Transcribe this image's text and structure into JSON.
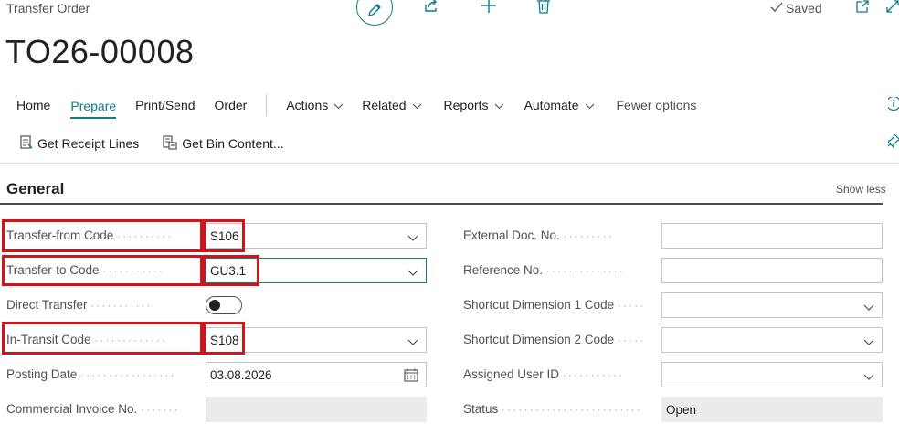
{
  "header": {
    "page_caption": "Transfer Order",
    "document_no": "TO26-00008",
    "saved_status": "Saved"
  },
  "menu": {
    "items": [
      {
        "label": "Home"
      },
      {
        "label": "Prepare",
        "active": true
      },
      {
        "label": "Print/Send"
      },
      {
        "label": "Order"
      },
      {
        "label": "Actions",
        "dropdown": true
      },
      {
        "label": "Related",
        "dropdown": true
      },
      {
        "label": "Reports",
        "dropdown": true
      },
      {
        "label": "Automate",
        "dropdown": true
      },
      {
        "label": "Fewer options"
      }
    ]
  },
  "subbar": {
    "get_receipt_lines": "Get Receipt Lines",
    "get_bin_content": "Get Bin Content..."
  },
  "general": {
    "title": "General",
    "show_less": "Show less",
    "left_fields": [
      {
        "label": "Transfer-from Code",
        "value": "S106",
        "type": "dropdown",
        "highlighted": true
      },
      {
        "label": "Transfer-to Code",
        "value": "GU3.1",
        "type": "dropdown",
        "highlighted": true,
        "focused": true
      },
      {
        "label": "Direct Transfer",
        "value": "off",
        "type": "toggle"
      },
      {
        "label": "In-Transit Code",
        "value": "S108",
        "type": "dropdown",
        "highlighted": true
      },
      {
        "label": "Posting Date",
        "value": "03.08.2026",
        "type": "date"
      },
      {
        "label": "Commercial Invoice No.",
        "value": "",
        "type": "readonly"
      }
    ],
    "right_fields": [
      {
        "label": "External Doc. No.",
        "value": "",
        "type": "text"
      },
      {
        "label": "Reference No.",
        "value": "",
        "type": "text"
      },
      {
        "label": "Shortcut Dimension 1 Code",
        "value": "",
        "type": "dropdown"
      },
      {
        "label": "Shortcut Dimension 2 Code",
        "value": "",
        "type": "dropdown"
      },
      {
        "label": "Assigned User ID",
        "value": "",
        "type": "dropdown"
      },
      {
        "label": "Status",
        "value": "Open",
        "type": "readonly"
      }
    ]
  },
  "colors": {
    "accent": "#0f7b8a",
    "highlight_box": "#d1141b",
    "readonly_bg": "#ebebeb"
  },
  "icons": {
    "edit": "pencil-icon",
    "share": "share-icon",
    "new": "plus-icon",
    "delete": "trash-icon",
    "saved": "checkmark-icon",
    "open_new_window": "open-new-window-icon",
    "expand": "expand-icon",
    "info": "info-icon",
    "pin": "pin-icon",
    "receipt": "document-lines-icon",
    "bin": "bin-content-icon",
    "calendar": "calendar-icon"
  }
}
